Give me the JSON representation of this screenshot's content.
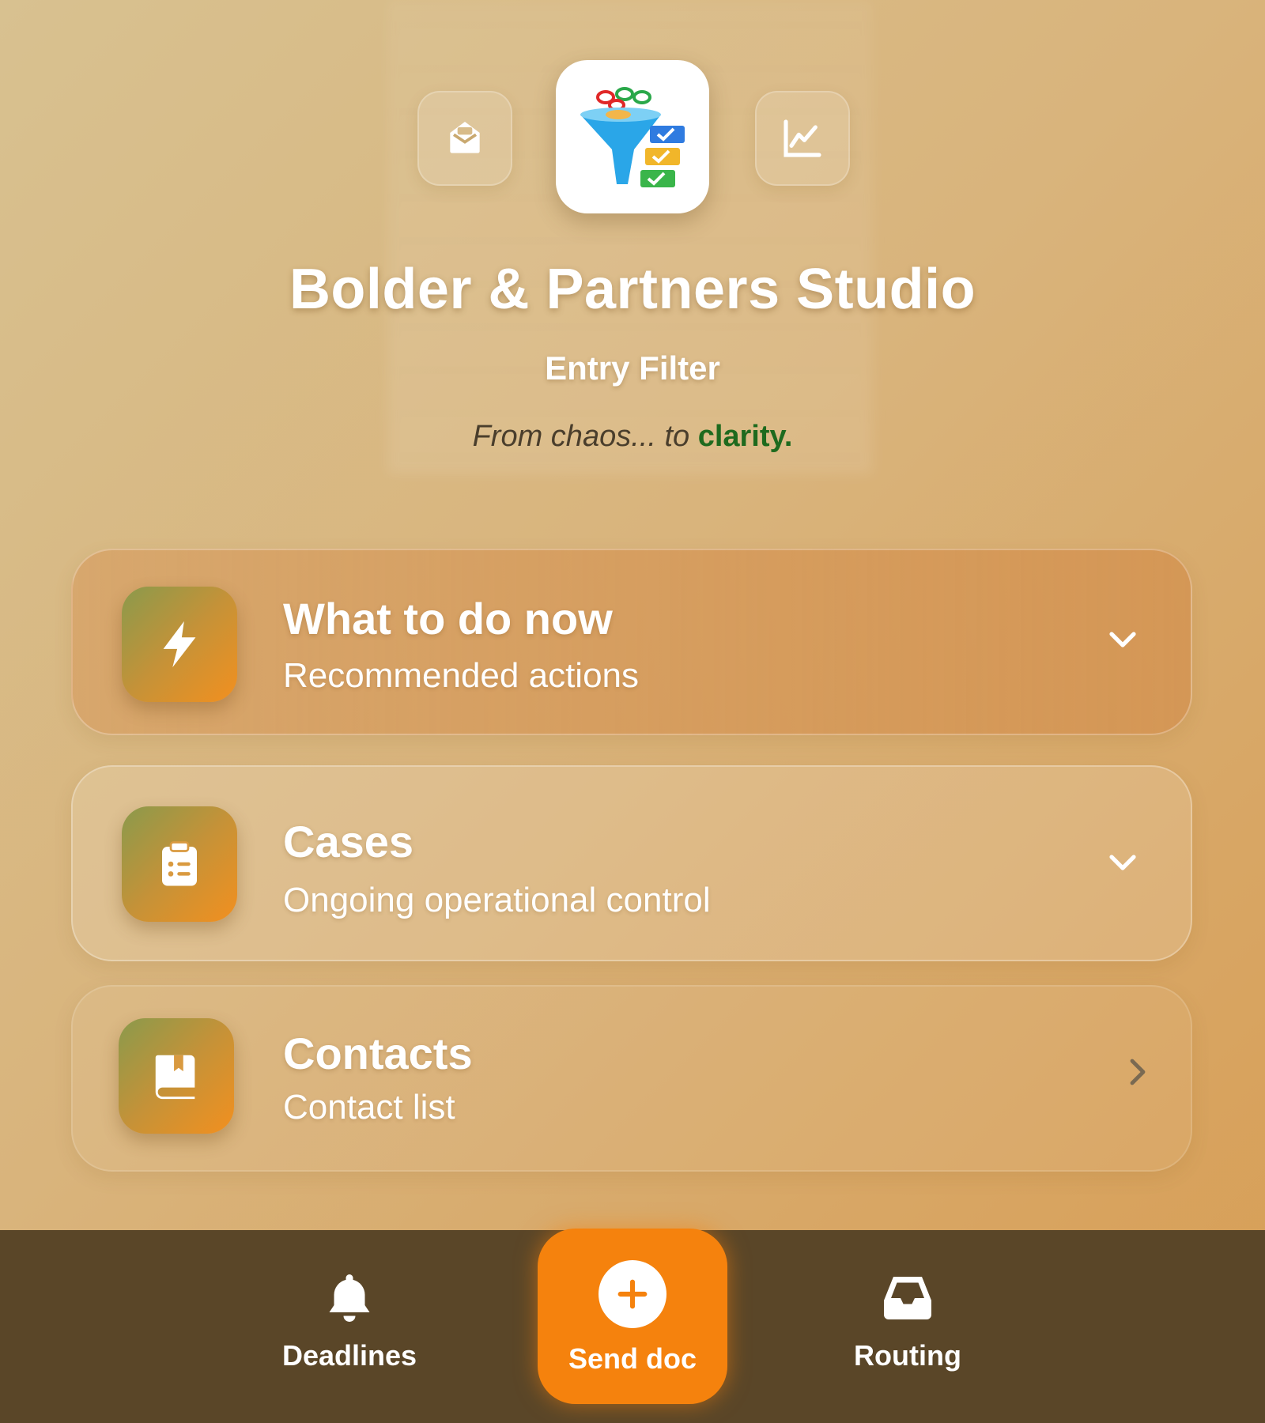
{
  "header": {
    "title": "Bolder & Partners Studio",
    "subtitle": "Entry Filter",
    "tagline_a": "From chaos... to ",
    "tagline_b": "clarity.",
    "left_button_icon": "inbox-envelope-icon",
    "right_button_icon": "line-chart-icon",
    "logo_icon": "funnel-checklist-logo"
  },
  "cards": [
    {
      "title": "What to do now",
      "subtitle": "Recommended actions",
      "icon": "lightning-icon",
      "indicator": "chevron-down-icon"
    },
    {
      "title": "Cases",
      "subtitle": "Ongoing operational control",
      "icon": "clipboard-list-icon",
      "indicator": "chevron-down-icon"
    },
    {
      "title": "Contacts",
      "subtitle": "Contact list",
      "icon": "address-book-icon",
      "indicator": "chevron-right-icon"
    }
  ],
  "bottom_nav": {
    "deadlines_label": "Deadlines",
    "send_label": "Send doc",
    "routing_label": "Routing"
  },
  "colors": {
    "accent": "#f5820d",
    "bottom_bar": "#5a4628",
    "tagline_highlight": "#1e6a1e"
  }
}
